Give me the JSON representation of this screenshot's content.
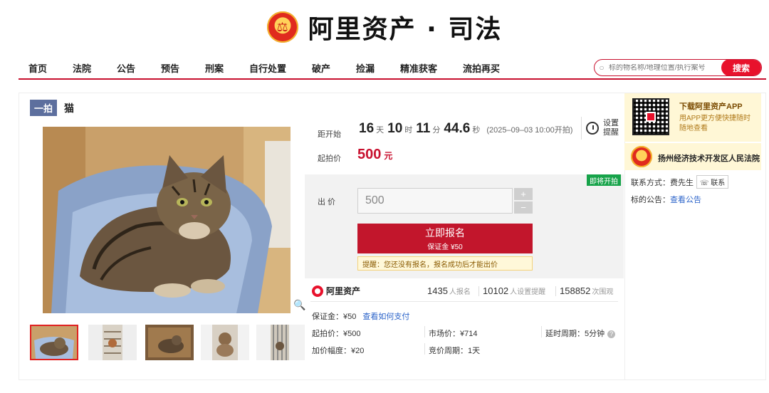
{
  "header": {
    "logo_text": "阿里资产 · 司法"
  },
  "nav": {
    "items": [
      "首页",
      "法院",
      "公告",
      "预告",
      "刑案",
      "自行处置",
      "破产",
      "捡漏",
      "精准获客",
      "流拍再买"
    ]
  },
  "search": {
    "placeholder": "标的物名称/地理位置/执行案号",
    "button_label": "搜索"
  },
  "item": {
    "tag": "一拍",
    "title": "猫"
  },
  "countdown": {
    "label": "距开始",
    "days": "16",
    "days_unit": "天",
    "hours": "10",
    "hours_unit": "时",
    "minutes": "11",
    "minutes_unit": "分",
    "seconds": "44.6",
    "seconds_unit": "秒",
    "start_time": "(2025–09–03 10:00开拍)"
  },
  "reminder": {
    "line1": "设置",
    "line2": "提醒"
  },
  "start_price": {
    "label": "起拍价",
    "value": "500",
    "unit": "元"
  },
  "bid": {
    "badge": "即将开拍",
    "label": "出 价",
    "input_value": "500",
    "plus": "+",
    "minus": "−",
    "signup_label": "立即报名",
    "deposit_label": "保证金 ¥50",
    "tip": "提醒：您还没有报名，报名成功后才能出价"
  },
  "stats": {
    "brand": "阿里资产",
    "signups": "1435",
    "signups_unit": "人报名",
    "reminders": "10102",
    "reminders_unit": "人设置提醒",
    "views": "158852",
    "views_unit": "次围观"
  },
  "details": {
    "deposit": "保证金：¥50",
    "how_to_pay": "查看如何支付",
    "start_price": "起拍价：¥500",
    "market_price": "市场价：¥714",
    "delay_period": "延时周期：5分钟",
    "increment": "加价幅度：¥20",
    "bid_period": "竞价周期：1天"
  },
  "sidebar": {
    "app_title": "下载阿里资产APP",
    "app_sub": "用APP更方便快捷随时随地查看",
    "court_name": "扬州经济技术开发区人民法院",
    "contact_label": "联系方式：费先生",
    "contact_button": "联系",
    "notice_label": "标的公告：",
    "notice_link": "查看公告"
  },
  "colors": {
    "brand_red": "#c8102e",
    "link_blue": "#2b63c9",
    "badge_green": "#17a34a"
  }
}
